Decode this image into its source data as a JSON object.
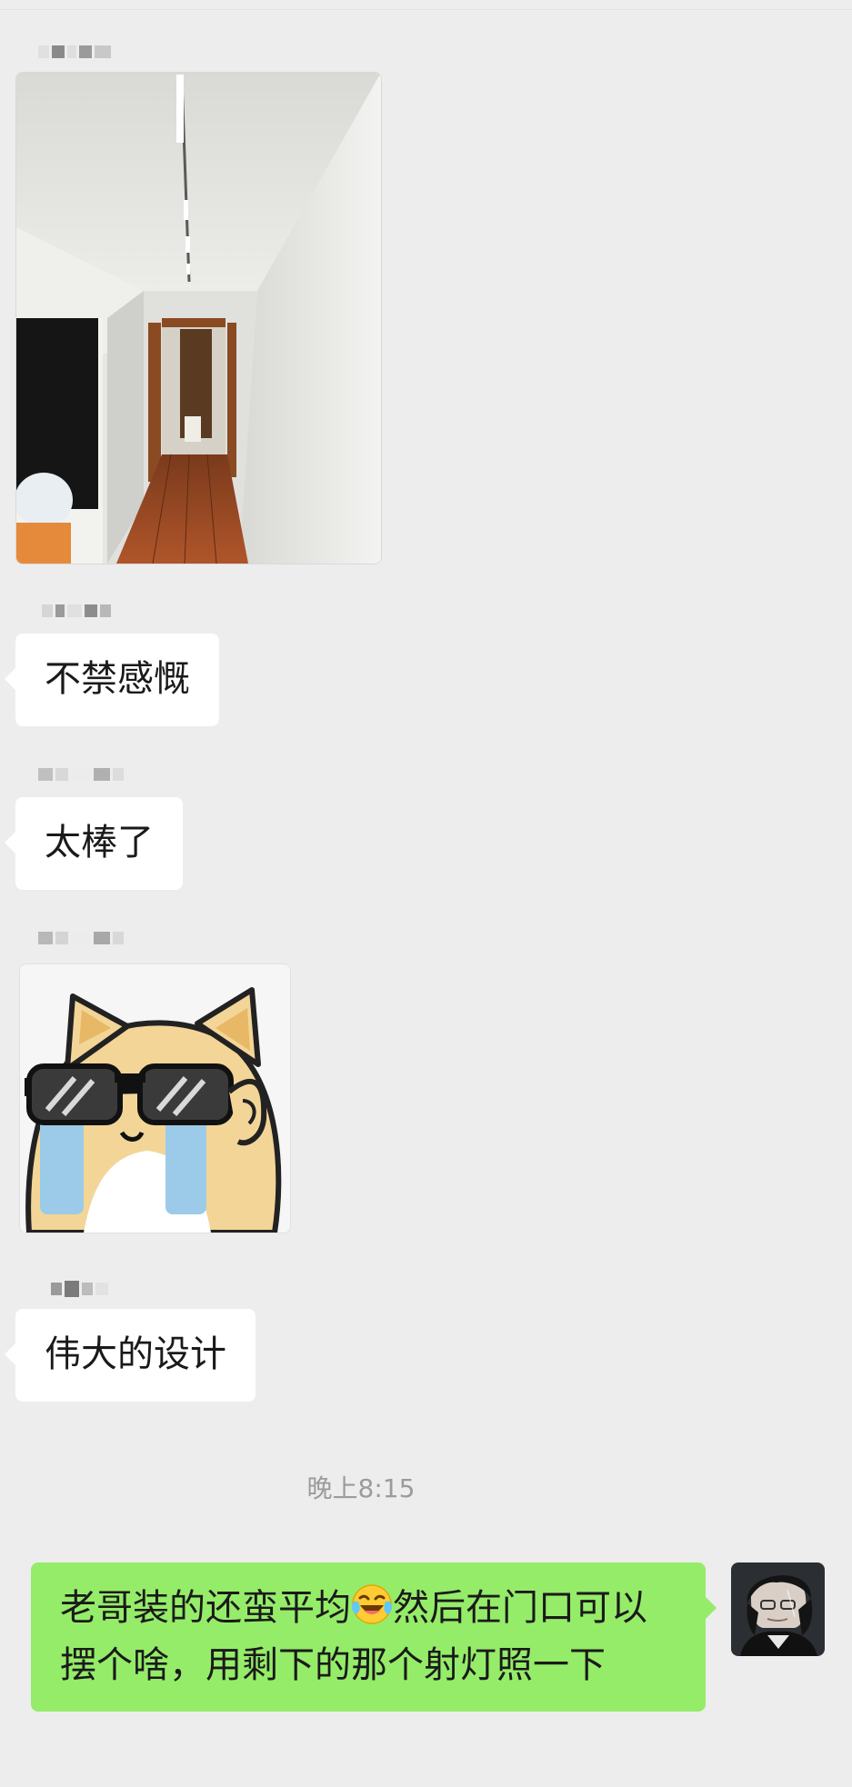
{
  "chat": {
    "messages": [
      {
        "type": "image",
        "sender": "left",
        "content": "hallway-photo"
      },
      {
        "type": "text",
        "sender": "left",
        "text": "不禁感慨"
      },
      {
        "type": "text",
        "sender": "left",
        "text": "太棒了"
      },
      {
        "type": "sticker",
        "sender": "left",
        "content": "shiba-dog-sunglasses-crying-sticker"
      },
      {
        "type": "text",
        "sender": "left",
        "text": "伟大的设计"
      }
    ],
    "timestamp": "晚上8:15",
    "own_message": {
      "text_before_emoji": "老哥装的还蛮平均",
      "emoji": "face-with-tears-of-joy",
      "text_after_emoji": "然后在门口可以摆个啥，用剩下的那个射灯照一下"
    }
  },
  "colors": {
    "background": "#ededed",
    "incoming_bubble": "#ffffff",
    "outgoing_bubble": "#95ec69",
    "timestamp_text": "#9b9b9b"
  }
}
